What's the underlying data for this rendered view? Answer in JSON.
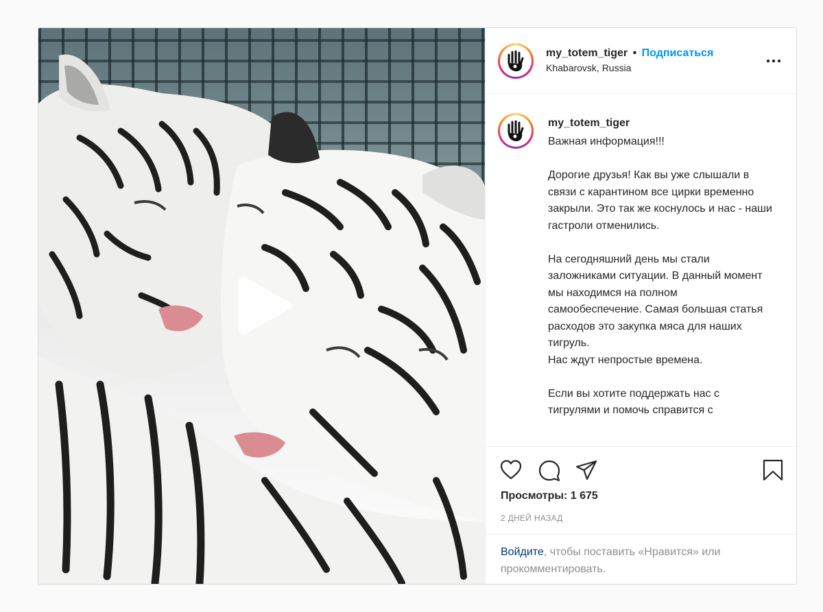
{
  "header": {
    "username": "my_totem_tiger",
    "separator": "•",
    "follow_label": "Подписаться",
    "location": "Khabarovsk, Russia",
    "more_icon": "more-horizontal-icon"
  },
  "caption": {
    "username": "my_totem_tiger",
    "text": "Важная информация!!!\n\nДорогие друзья! Как вы уже слышали в связи с карантином все цирки временно закрыли. Это так же коснулось и нас - наши гастроли отменились.\n\nНа сегодняшний день мы стали заложниками ситуации. В данный момент мы находимся на полном самообеспечение. Самая большая статья расходов это закупка мяса для наших тигруль.\nНас ждут непростые времена.\n\nЕсли вы хотите поддержать нас с тигрулями и помочь справится с"
  },
  "actions": {
    "icons": [
      "heart-icon",
      "comment-icon",
      "share-icon",
      "bookmark-icon"
    ],
    "views_label": "Просмотры: 1 675",
    "timestamp": "2 ДНЕЙ НАЗАД"
  },
  "login_prompt": {
    "link": "Войдите",
    "text": ", чтобы поставить «Нравится» или прокомментировать."
  },
  "colors": {
    "accent": "#0095f6",
    "link_dark": "#00376b",
    "muted": "#8e8e8e",
    "border": "#dbdbdb"
  }
}
